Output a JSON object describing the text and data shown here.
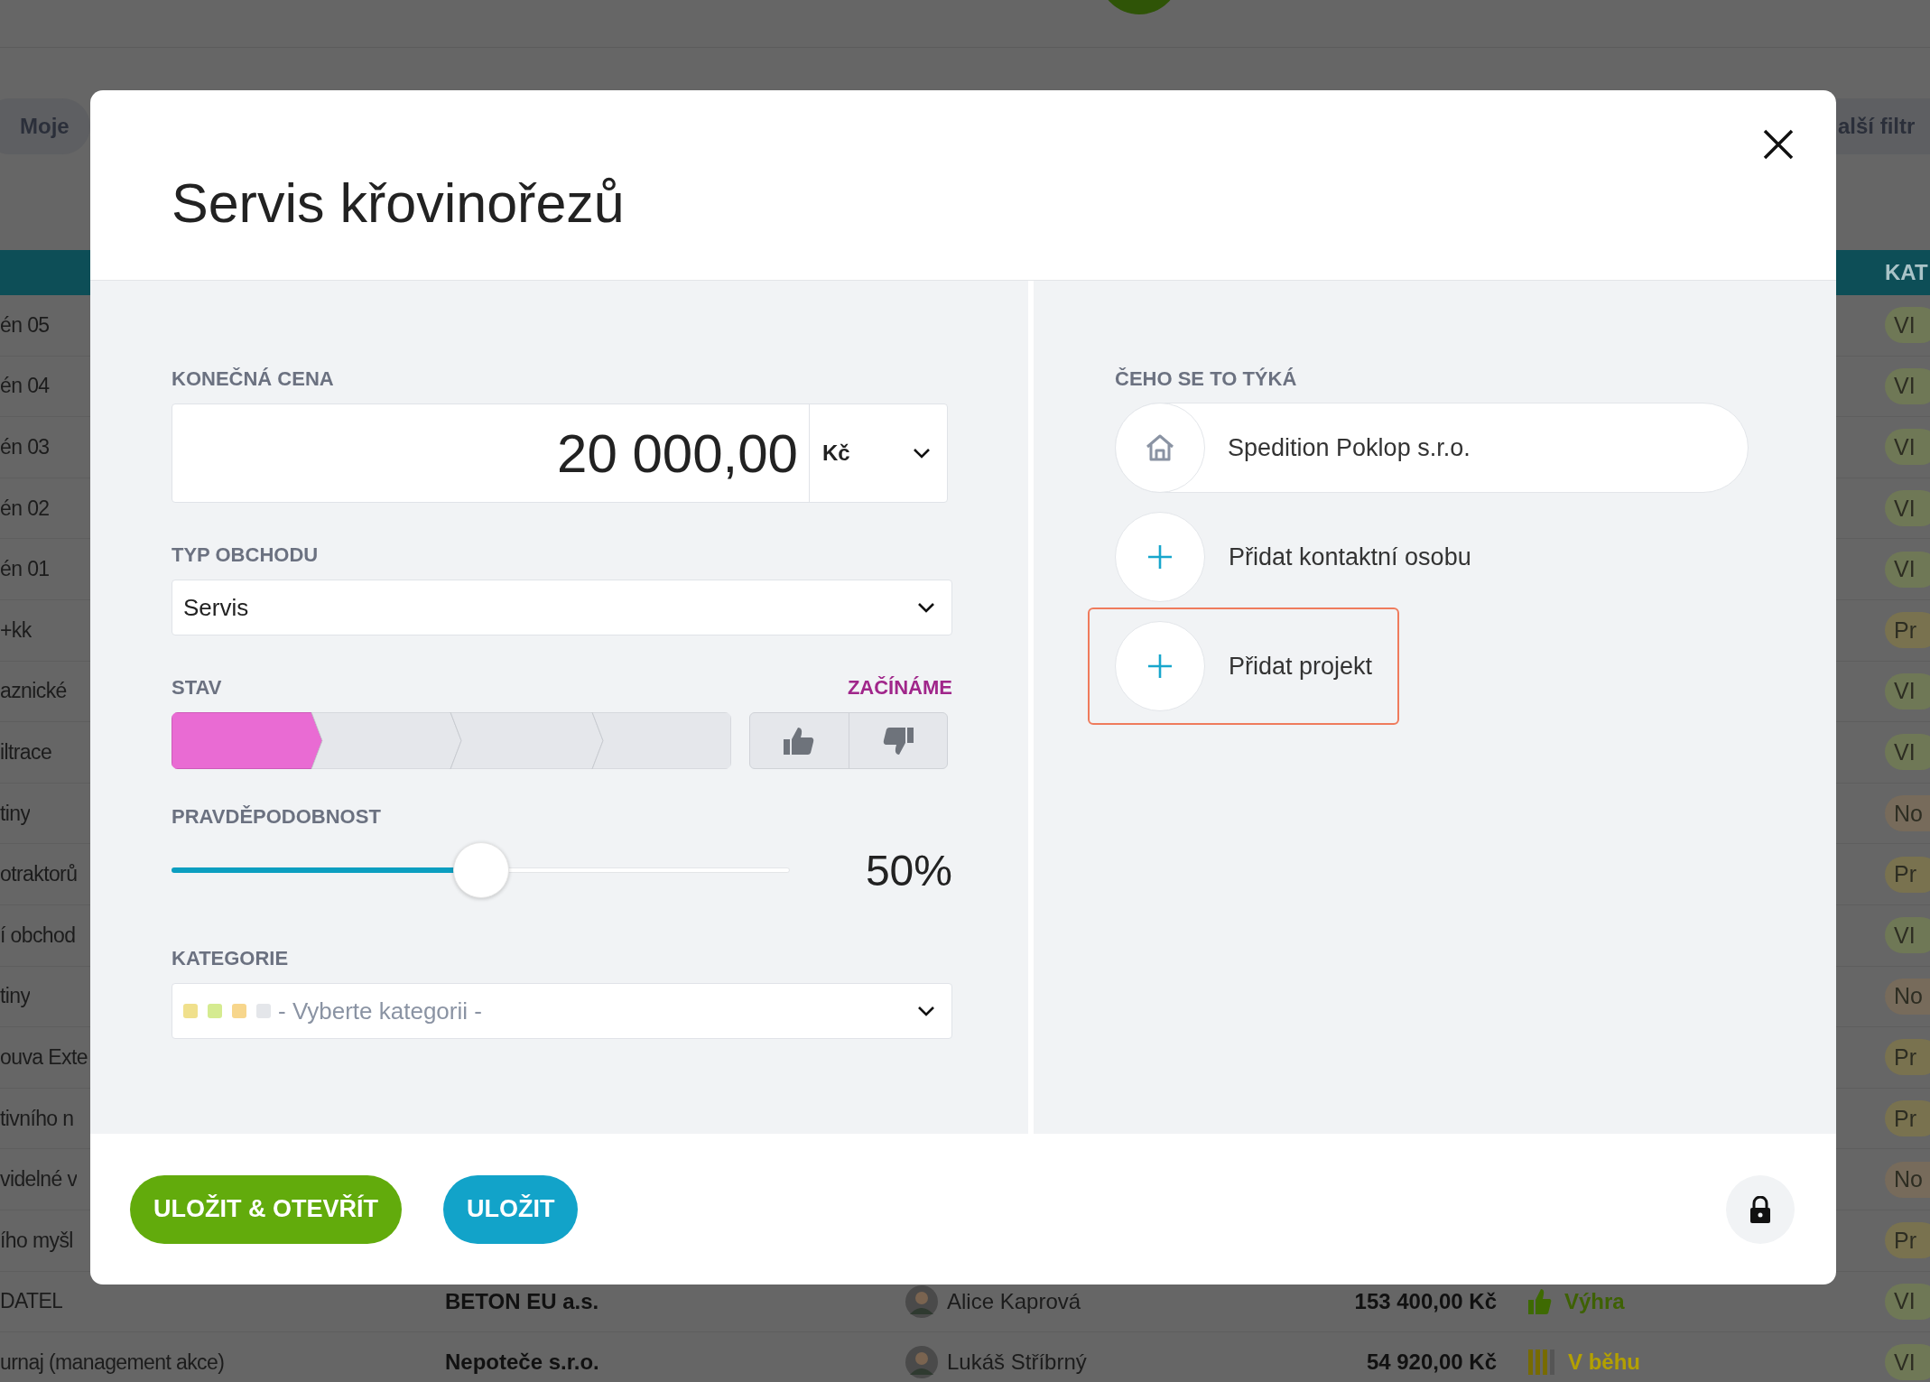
{
  "background": {
    "filter_chip": "Moje",
    "more_filters": "alší filtr",
    "category_header": "KAT",
    "rows": [
      {
        "name": "én 05",
        "category": "VI",
        "color": "#6f7856"
      },
      {
        "name": "én 04",
        "category": "VI",
        "color": "#6f7856"
      },
      {
        "name": "én 03",
        "category": "VI",
        "color": "#6f7856"
      },
      {
        "name": "én 02",
        "category": "VI",
        "color": "#6f7856"
      },
      {
        "name": "én 01",
        "category": "VI",
        "color": "#6f7856"
      },
      {
        "name": "+kk",
        "category": "Pr",
        "color": "#79724f"
      },
      {
        "name": "aznické",
        "category": "VI",
        "color": "#6f7856"
      },
      {
        "name": "iltrace",
        "category": "VI",
        "color": "#6f7856"
      },
      {
        "name": "tiny",
        "category": "No",
        "color": "#776b5b"
      },
      {
        "name": "otraktorů",
        "category": "Pr",
        "color": "#79724f"
      },
      {
        "name": "í obchod",
        "category": "VI",
        "color": "#6f7856"
      },
      {
        "name": "tiny",
        "category": "No",
        "color": "#776b5b"
      },
      {
        "name": "ouva Exte",
        "category": "Pr",
        "color": "#79724f"
      },
      {
        "name": "tivního n",
        "category": "Pr",
        "color": "#79724f"
      },
      {
        "name": "videlné v",
        "category": "No",
        "color": "#776b5b"
      },
      {
        "name": "ího myšl",
        "category": "Pr",
        "color": "#79724f"
      }
    ],
    "full_rows": [
      {
        "name": "DATEL",
        "company": "BETON EU a.s.",
        "person": "Alice Kaprová",
        "amount": "153 400,00 Kč",
        "status": "Výhra",
        "kind": "won",
        "category": "VI",
        "color": "#6f7856"
      },
      {
        "name": "urnaj (management akce)",
        "company": "Nepoteče s.r.o.",
        "person": "Lukáš Stříbrný",
        "amount": "54 920,00 Kč",
        "status": "V běhu",
        "kind": "running",
        "category": "VI",
        "color": "#6f7856"
      }
    ]
  },
  "modal": {
    "title": "Servis křovinořezů",
    "price": {
      "label": "KONEČNÁ CENA",
      "value": "20 000,00",
      "currency": "Kč"
    },
    "deal_type": {
      "label": "TYP OBCHODU",
      "value": "Servis"
    },
    "stage": {
      "label": "STAV",
      "current": "ZAČÍNÁME",
      "steps": [
        {
          "done": true
        },
        {
          "done": false
        },
        {
          "done": false
        },
        {
          "done": false
        }
      ]
    },
    "probability": {
      "label": "PRAVDĚPODOBNOST",
      "level": 0.5,
      "reading": "50%"
    },
    "category": {
      "label": "KATEGORIE",
      "placeholder": "- Vyberte kategorii -",
      "swatches": [
        {
          "color": "#f0e08c"
        },
        {
          "color": "#d5eb90"
        },
        {
          "color": "#f7d68c"
        },
        {
          "color": "#e4e6ea"
        }
      ]
    },
    "related": {
      "label": "ČEHO SE TO TÝKÁ",
      "items": [
        {
          "kind": "company",
          "text": "Spedition Poklop s.r.o.",
          "highlighted": false
        },
        {
          "kind": "add",
          "text": "Přidat kontaktní osobu",
          "highlighted": false
        },
        {
          "kind": "add",
          "text": "Přidat projekt",
          "highlighted": true
        }
      ]
    },
    "buttons": [
      {
        "kind": "primary",
        "label": "ULOŽIT & OTEVŘÍT"
      },
      {
        "kind": "secondary",
        "label": "ULOŽIT"
      }
    ],
    "locked": true
  }
}
